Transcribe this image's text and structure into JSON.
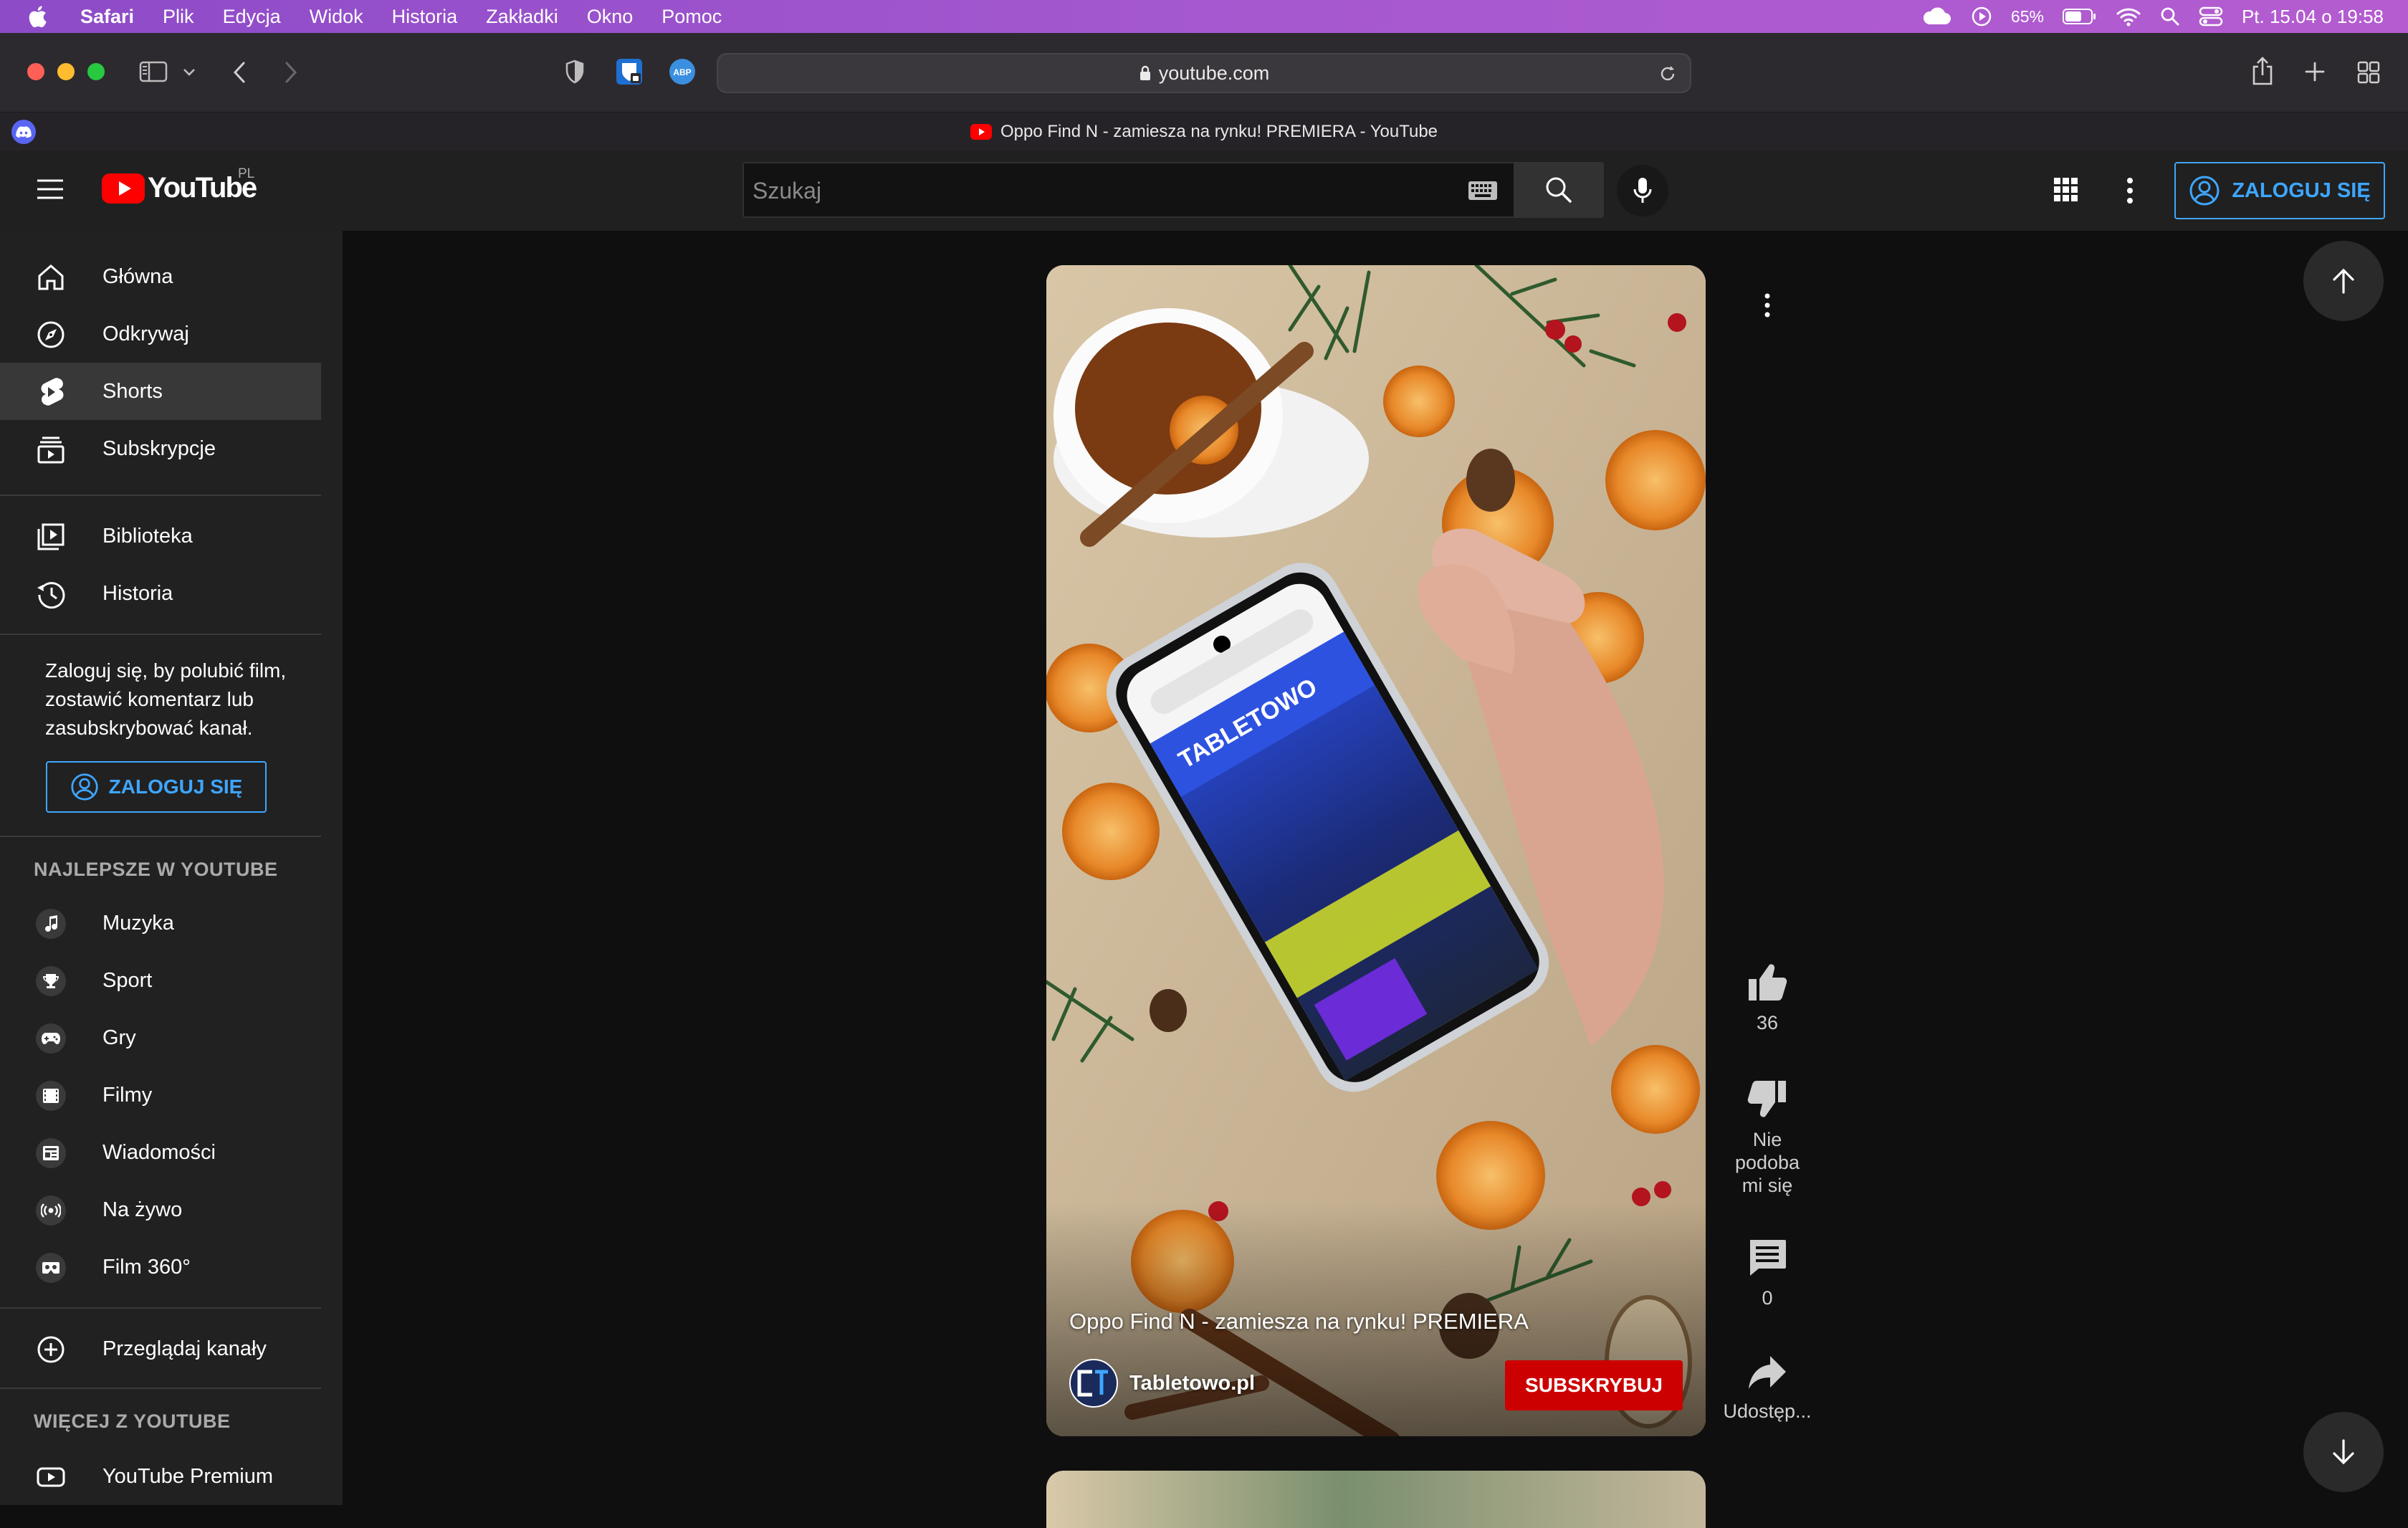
{
  "menubar": {
    "items": [
      "Safari",
      "Plik",
      "Edycja",
      "Widok",
      "Historia",
      "Zakładki",
      "Okno",
      "Pomoc"
    ],
    "battery": "65%",
    "datetime": "Pt. 15.04 o 19:58"
  },
  "browser": {
    "url": "youtube.com",
    "tab_title": "Oppo Find N - zamiesza na rynku! PREMIERA - YouTube"
  },
  "youtube": {
    "logo_text": "YouTube",
    "region": "PL",
    "search_placeholder": "Szukaj",
    "signin_label": "ZALOGUJ SIĘ"
  },
  "sidebar": {
    "main": [
      "Główna",
      "Odkrywaj",
      "Shorts",
      "Subskrypcje"
    ],
    "library": [
      "Biblioteka",
      "Historia"
    ],
    "signin_prompt": "Zaloguj się, by polubić film, zostawić komentarz lub zasubskrybować kanał.",
    "signin_label": "ZALOGUJ SIĘ",
    "best_header": "NAJLEPSZE W YOUTUBE",
    "best": [
      "Muzyka",
      "Sport",
      "Gry",
      "Filmy",
      "Wiadomości",
      "Na żywo",
      "Film 360°"
    ],
    "browse_channels": "Przeglądaj kanały",
    "more_header": "WIĘCEJ Z YOUTUBE",
    "more": [
      "YouTube Premium"
    ]
  },
  "short": {
    "title": "Oppo Find N - zamiesza na rynku! PREMIERA",
    "channel": "Tabletowo.pl",
    "subscribe_label": "SUBSKRYBUJ",
    "likes": "36",
    "dislike_label": "Nie podoba mi się",
    "comments": "0",
    "share_label": "Udostęp..."
  },
  "colors": {
    "accent_blue": "#3ea6ff",
    "subscribe_red": "#cc0000",
    "youtube_red": "#ff0000"
  }
}
